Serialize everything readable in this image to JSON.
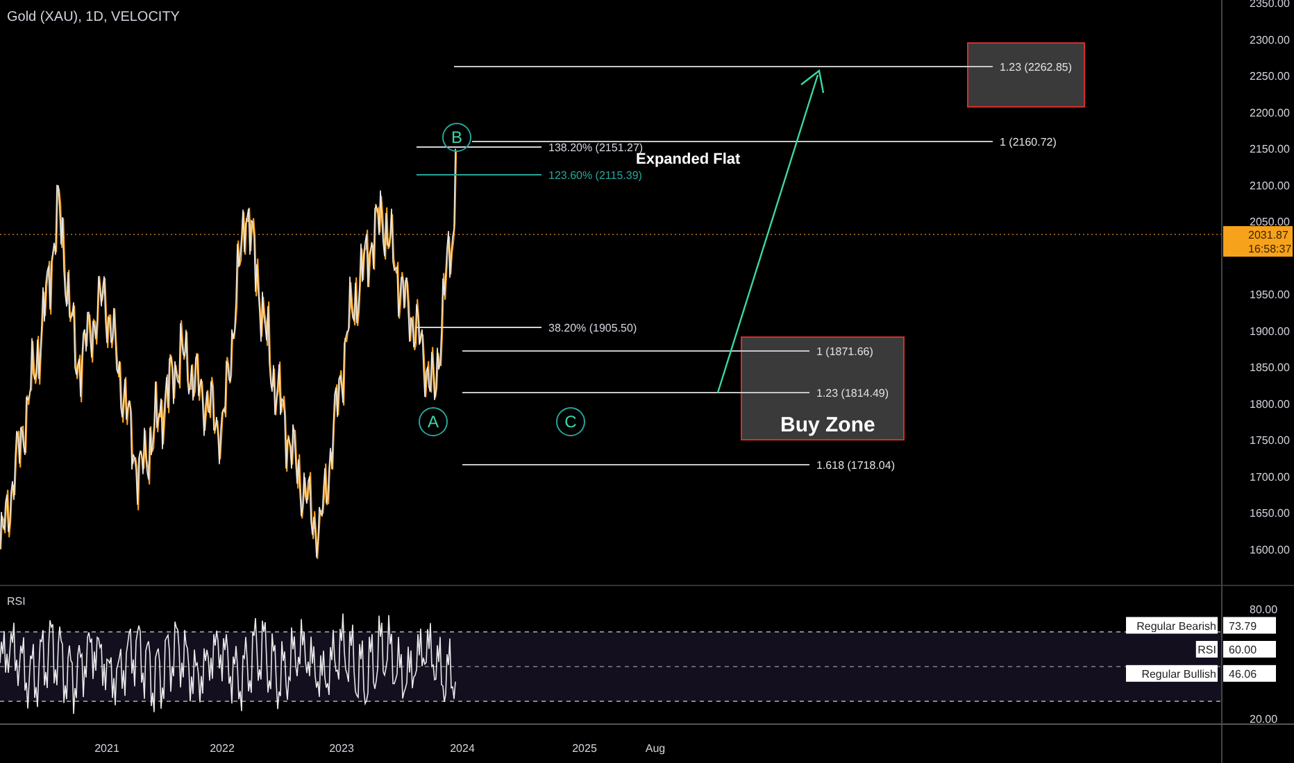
{
  "header": {
    "title": "Gold (XAU), 1D, VELOCITY"
  },
  "price_axis": {
    "ticks": [
      "2350.00",
      "2300.00",
      "2250.00",
      "2200.00",
      "2150.00",
      "2100.00",
      "2050.00",
      "1950.00",
      "1900.00",
      "1850.00",
      "1800.00",
      "1750.00",
      "1700.00",
      "1650.00",
      "1600.00"
    ],
    "last_price": "2031.87",
    "countdown": "16:58:37"
  },
  "wave_labels": [
    "B",
    "A",
    "C"
  ],
  "fib_levels": [
    {
      "label": "138.20% (2151.27)",
      "color": "#d1d4dc"
    },
    {
      "label": "123.60% (2115.39)",
      "color": "#26a69a"
    },
    {
      "label": "38.20% (1905.50)",
      "color": "#d1d4dc"
    }
  ],
  "projection_levels": [
    {
      "label": "1.23 (2262.85)"
    },
    {
      "label": "1 (2160.72)"
    },
    {
      "label": "1 (1871.66)"
    },
    {
      "label": "1.23 (1814.49)"
    },
    {
      "label": "1.618 (1718.04)"
    }
  ],
  "notes": {
    "pattern": "Expanded Flat",
    "zone": "Buy Zone"
  },
  "rsi": {
    "title": "RSI",
    "ticks": [
      "80.00",
      "20.00"
    ],
    "labels": [
      {
        "name": "Regular Bearish",
        "value": "73.79"
      },
      {
        "name": "RSI",
        "value": "60.00"
      },
      {
        "name": "Regular Bullish",
        "value": "46.06"
      }
    ]
  },
  "time_axis": [
    "2021",
    "2022",
    "2023",
    "2024",
    "2025",
    "Aug"
  ]
}
